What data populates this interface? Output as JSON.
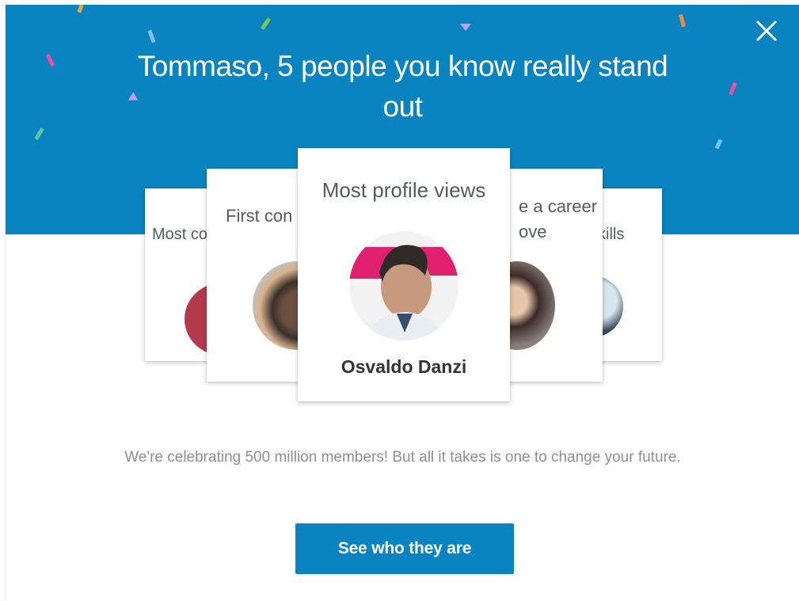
{
  "modal": {
    "headline": "Tommaso, 5 people you know really stand out",
    "close_icon": "close-icon",
    "accent_color": "#0a84c1"
  },
  "cards": [
    {
      "title_partial": "Most co",
      "position": "far-left"
    },
    {
      "title_partial": "First con",
      "position": "left"
    },
    {
      "title": "Most profile views",
      "name": "Osvaldo Danzi",
      "position": "center"
    },
    {
      "title_partial": "e a career\nove",
      "position": "right"
    },
    {
      "title_partial": "kills",
      "position": "far-right"
    }
  ],
  "footer": {
    "message": "We're celebrating 500 million members! But all it takes is one to change your future.",
    "cta_label": "See who they are"
  }
}
